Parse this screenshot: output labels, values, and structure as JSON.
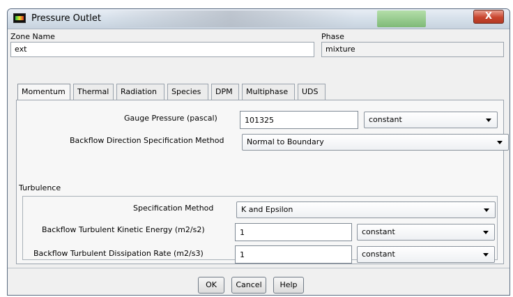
{
  "window": {
    "title": "Pressure Outlet",
    "close_glyph": "X"
  },
  "zone": {
    "label": "Zone Name",
    "value": "ext"
  },
  "phase": {
    "label": "Phase",
    "value": "mixture"
  },
  "tabs": [
    {
      "label": "Momentum",
      "active": true
    },
    {
      "label": "Thermal"
    },
    {
      "label": "Radiation"
    },
    {
      "label": "Species"
    },
    {
      "label": "DPM"
    },
    {
      "label": "Multiphase"
    },
    {
      "label": "UDS"
    }
  ],
  "momentum": {
    "gauge_pressure": {
      "label": "Gauge Pressure (pascal)",
      "value": "101325",
      "profile": "constant"
    },
    "backflow_direction": {
      "label": "Backflow Direction Specification Method",
      "value": "Normal to Boundary"
    },
    "turbulence": {
      "title": "Turbulence",
      "spec_method": {
        "label": "Specification Method",
        "value": "K and Epsilon"
      },
      "tke": {
        "label": "Backflow Turbulent Kinetic Energy (m2/s2)",
        "value": "1",
        "profile": "constant"
      },
      "dissipation": {
        "label": "Backflow Turbulent Dissipation Rate (m2/s3)",
        "value": "1",
        "profile": "constant"
      }
    }
  },
  "buttons": {
    "ok": "OK",
    "cancel": "Cancel",
    "help": "Help"
  },
  "icons": {
    "app": "fluent-app-icon",
    "close": "close-icon",
    "dropdown": "chevron-down-icon"
  }
}
